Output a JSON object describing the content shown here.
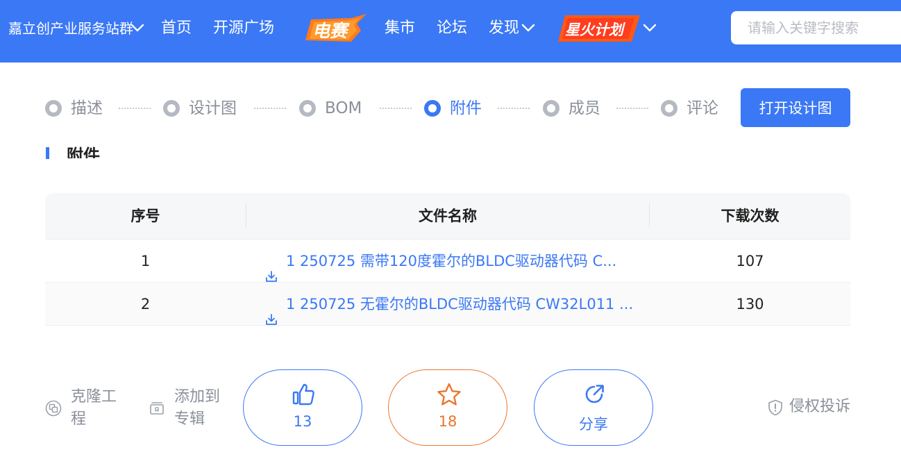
{
  "nav": {
    "group_label": "嘉立创产业服务站群",
    "home": "首页",
    "open_source_square": "开源广场",
    "contest_logo_text": "电赛",
    "market": "集市",
    "forum": "论坛",
    "discover": "发现",
    "spark_logo_text": "星火计划",
    "search_placeholder": "请输入关键字搜索"
  },
  "steps": [
    {
      "label": "描述",
      "active": false
    },
    {
      "label": "设计图",
      "active": false
    },
    {
      "label": "BOM",
      "active": false
    },
    {
      "label": "附件",
      "active": true
    },
    {
      "label": "成员",
      "active": false
    },
    {
      "label": "评论",
      "active": false
    }
  ],
  "open_design_button": "打开设计图",
  "section_title": "附件",
  "table": {
    "headers": [
      "序号",
      "文件名称",
      "下载次数"
    ],
    "rows": [
      {
        "index": "1",
        "file_name": "1 250725 需带120度霍尔的BLDC驱动器代码 C...",
        "downloads": "107"
      },
      {
        "index": "2",
        "file_name": "1 250725 无霍尔的BLDC驱动器代码 CW32L011 ...",
        "downloads": "130"
      }
    ]
  },
  "actions": {
    "clone": "克隆工程",
    "add_to_album": "添加到专辑",
    "like_count": "13",
    "favorite_count": "18",
    "share": "分享",
    "report": "侵权投诉"
  },
  "colors": {
    "brand": "#3a78f5",
    "favorite": "#e8772e",
    "muted": "#8a8f99"
  },
  "icons": {
    "like": "thumbs-up-icon",
    "favorite": "star-icon",
    "share": "share-icon",
    "download": "download-icon",
    "clone": "clone-icon",
    "album": "album-icon",
    "report": "shield-icon"
  }
}
